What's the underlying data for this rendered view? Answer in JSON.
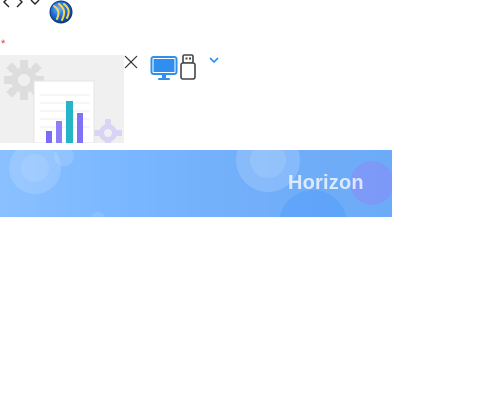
{
  "toolbar": {
    "back_icon": "chevron-left-icon",
    "forward_icon": "chevron-right-icon",
    "menu_icon": "chevron-down-icon"
  },
  "brand": {
    "logo_icon": "globe-logo-icon",
    "accent": "#1c6fd6"
  },
  "form": {
    "required_mark": "*",
    "required_color": "#e53935"
  },
  "thumbnail": {
    "icon": "chart-thumbnail-icon",
    "bar_colors": [
      "#7b6cf6",
      "#8e7ff7",
      "#27b4c6",
      "#7f72f6"
    ]
  },
  "device_switch": {
    "monitor_icon": "monitor-icon",
    "usb_icon": "usb-drive-icon",
    "dropdown_icon": "chevron-down-icon",
    "active_color": "#2f8ff0",
    "inactive_color": "#444444"
  },
  "banner": {
    "title": "Horizon",
    "gradient": [
      "#8ac0ff",
      "#6cabf7"
    ]
  }
}
